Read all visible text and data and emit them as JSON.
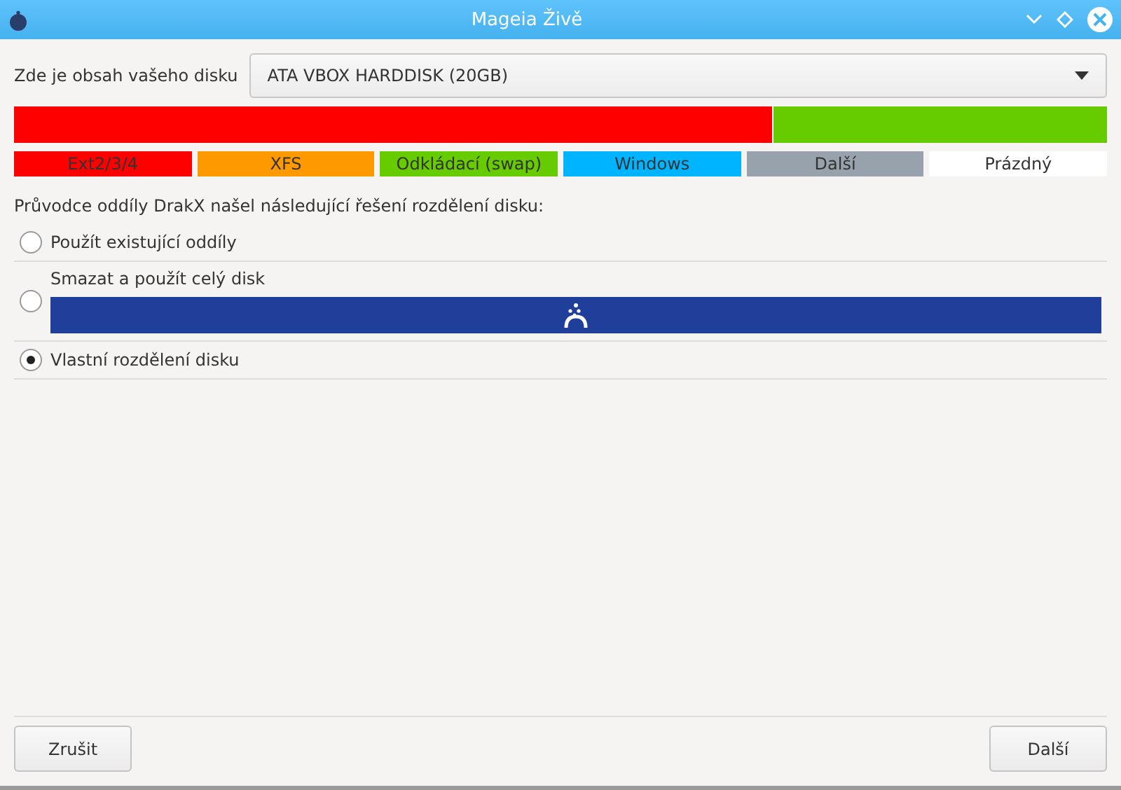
{
  "window": {
    "title": "Mageia Živě"
  },
  "disk_select": {
    "label": "Zde je obsah vašeho disku",
    "value": "ATA VBOX HARDDISK (20GB)"
  },
  "disk_bar": [
    {
      "color": "#ff0000",
      "level": 0.695
    },
    {
      "color": "#66cc00",
      "level": 0.305
    }
  ],
  "legend": [
    {
      "label": "Ext2/3/4",
      "color": "#ff0000"
    },
    {
      "label": "XFS",
      "color": "#ff9900"
    },
    {
      "label": "Odkládací (swap)",
      "color": "#66cc00"
    },
    {
      "label": "Windows",
      "color": "#00b4ff"
    },
    {
      "label": "Další",
      "color": "#98a2ad"
    },
    {
      "label": "Prázdný",
      "color": "#ffffff"
    }
  ],
  "intro": "Průvodce oddíly DrakX našel následující řešení rozdělení disku:",
  "options": [
    {
      "kind": "plain",
      "label": "Použít existující oddíly",
      "selected": false
    },
    {
      "kind": "preview",
      "label": "Smazat a použít celý disk",
      "selected": false
    },
    {
      "kind": "plain",
      "label": "Vlastní rozdělení disku",
      "selected": true
    }
  ],
  "buttons": {
    "cancel": "Zrušit",
    "next": "Další"
  }
}
